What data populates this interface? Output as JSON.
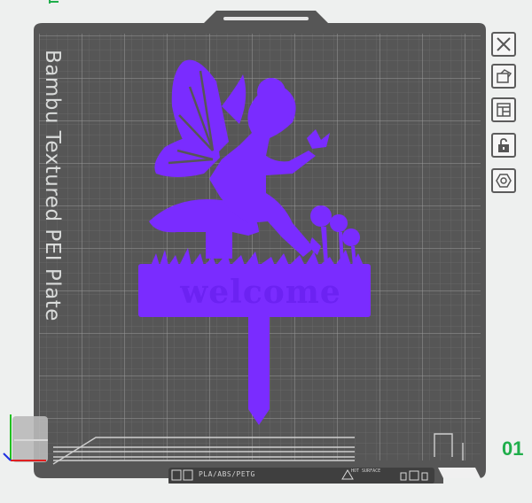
{
  "plate": {
    "label": "Bambu Textured PEI Plate",
    "number": "01",
    "material_label": "PLA/ABS/PETG",
    "surface_label": "HOT SURFACE"
  },
  "model": {
    "name": "fairy-welcome-sign",
    "sign_text": "welcome",
    "color": "#7a2cff"
  },
  "toolbar": {
    "items": [
      {
        "name": "close-button",
        "icon": "close-icon"
      },
      {
        "name": "arrange-button",
        "icon": "arrange-icon"
      },
      {
        "name": "layout-button",
        "icon": "layout-icon"
      },
      {
        "name": "lock-button",
        "icon": "lock-icon"
      },
      {
        "name": "settings-button",
        "icon": "hexagon-settings-icon"
      }
    ]
  },
  "colors": {
    "bed": "#5a5a5a",
    "grid": "#8a8a8a",
    "accent_green": "#1fae4b",
    "model_purple": "#7a2cff"
  }
}
